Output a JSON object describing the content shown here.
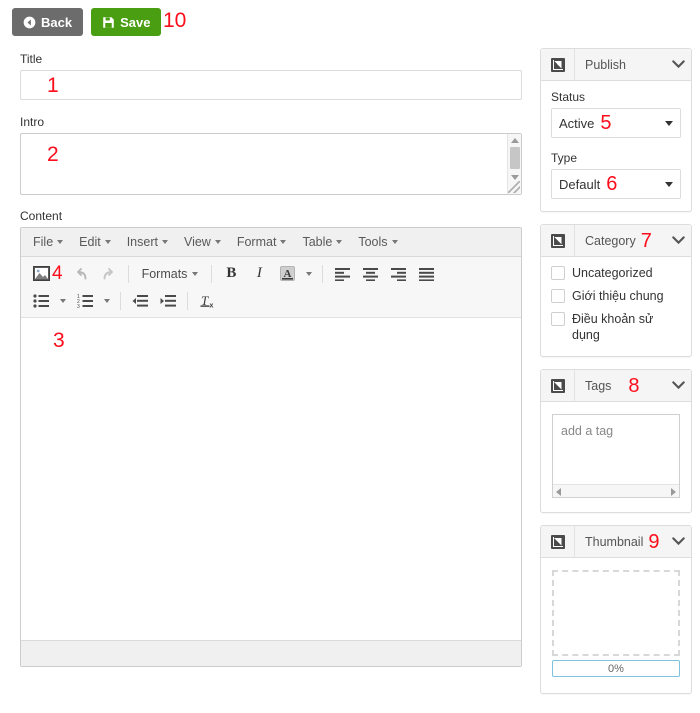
{
  "toolbar": {
    "back_label": "Back",
    "save_label": "Save",
    "back_icon": "arrow-left-circle-icon",
    "save_icon": "floppy-disk-icon",
    "marker_10": "10"
  },
  "colors": {
    "back_button": "#6c6c6c",
    "save_button": "#4a9e11",
    "marker": "#fc0d1b",
    "panel_header": "#f5f5f5",
    "progress_border": "#7ec2dd"
  },
  "form": {
    "title": {
      "label": "Title",
      "value": "",
      "placeholder": "",
      "marker": "1"
    },
    "intro": {
      "label": "Intro",
      "value": "",
      "placeholder": "",
      "marker": "2"
    },
    "content": {
      "label": "Content",
      "value": "",
      "marker": "3"
    }
  },
  "editor": {
    "menubar": [
      {
        "label": "File"
      },
      {
        "label": "Edit"
      },
      {
        "label": "Insert"
      },
      {
        "label": "View"
      },
      {
        "label": "Format"
      },
      {
        "label": "Table"
      },
      {
        "label": "Tools"
      }
    ],
    "row1": {
      "image_icon": "image-icon",
      "image_marker": "4",
      "undo_icon": "undo-arrow-icon",
      "redo_icon": "redo-arrow-icon",
      "formats_label": "Formats",
      "bold_label": "B",
      "italic_label": "I",
      "textcolor_label": "A",
      "align_left_icon": "align-left-icon",
      "align_center_icon": "align-center-icon",
      "align_right_icon": "align-right-icon",
      "align_justify_icon": "align-justify-icon"
    },
    "row2": {
      "bullist_icon": "bullet-list-icon",
      "numlist_icon": "numbered-list-icon",
      "outdent_icon": "outdent-icon",
      "indent_icon": "indent-icon",
      "removeformat_icon": "remove-format-icon"
    },
    "statusbar_text": ""
  },
  "panels": {
    "publish": {
      "title": "Publish",
      "marker": "5_6_note",
      "icon": "expand-arrow-icon",
      "collapse_icon": "chevron-down-icon",
      "status": {
        "label": "Status",
        "value": "Active",
        "marker": "5",
        "options": [
          "Active"
        ]
      },
      "type": {
        "label": "Type",
        "value": "Default",
        "marker": "6",
        "options": [
          "Default"
        ]
      }
    },
    "category": {
      "title": "Category",
      "marker": "7",
      "icon": "expand-arrow-icon",
      "collapse_icon": "chevron-down-icon",
      "items": [
        {
          "label": "Uncategorized",
          "checked": false
        },
        {
          "label": "Giới thiệu chung",
          "checked": false
        },
        {
          "label": "Điều khoản sử dụng",
          "checked": false
        }
      ]
    },
    "tags": {
      "title": "Tags",
      "marker": "8",
      "icon": "expand-arrow-icon",
      "collapse_icon": "chevron-down-icon",
      "input_placeholder": "add a tag",
      "input_value": ""
    },
    "thumbnail": {
      "title": "Thumbnail",
      "marker": "9",
      "icon": "expand-arrow-icon",
      "collapse_icon": "chevron-down-icon",
      "dropzone_label": "",
      "progress_text": "0%",
      "progress_value": 0
    }
  }
}
